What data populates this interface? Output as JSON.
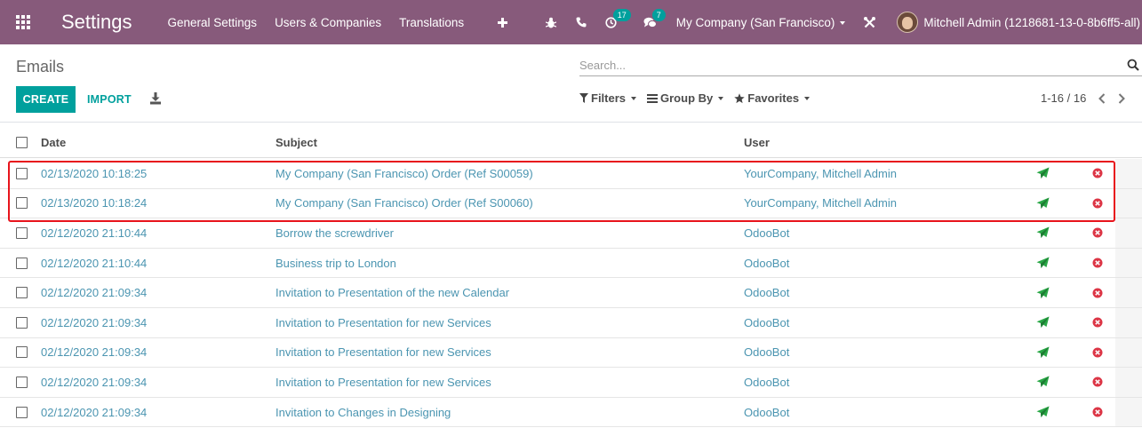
{
  "navbar": {
    "app_title": "Settings",
    "menu": [
      "General Settings",
      "Users & Companies",
      "Translations"
    ],
    "activity_count": "17",
    "messages_count": "7",
    "company": "My Company (San Francisco)",
    "user": "Mitchell Admin (1218681-13-0-8b6ff5-all)",
    "color": "#875a7b"
  },
  "control_panel": {
    "title": "Emails",
    "search_placeholder": "Search...",
    "create_label": "CREATE",
    "import_label": "IMPORT",
    "filters_label": "Filters",
    "groupby_label": "Group By",
    "favorites_label": "Favorites",
    "pager": "1-16 / 16",
    "accent": "#00a09d"
  },
  "table": {
    "columns": [
      "Date",
      "Subject",
      "User"
    ],
    "rows": [
      {
        "date": "02/13/2020 10:18:25",
        "subject": "My Company (San Francisco) Order (Ref S00059)",
        "user": "YourCompany, Mitchell Admin"
      },
      {
        "date": "02/13/2020 10:18:24",
        "subject": "My Company (San Francisco) Order (Ref S00060)",
        "user": "YourCompany, Mitchell Admin"
      },
      {
        "date": "02/12/2020 21:10:44",
        "subject": "Borrow the screwdriver",
        "user": "OdooBot"
      },
      {
        "date": "02/12/2020 21:10:44",
        "subject": "Business trip to London",
        "user": "OdooBot"
      },
      {
        "date": "02/12/2020 21:09:34",
        "subject": "Invitation to Presentation of the new Calendar",
        "user": "OdooBot"
      },
      {
        "date": "02/12/2020 21:09:34",
        "subject": "Invitation to Presentation for new Services",
        "user": "OdooBot"
      },
      {
        "date": "02/12/2020 21:09:34",
        "subject": "Invitation to Presentation for new Services",
        "user": "OdooBot"
      },
      {
        "date": "02/12/2020 21:09:34",
        "subject": "Invitation to Presentation for new Services",
        "user": "OdooBot"
      },
      {
        "date": "02/12/2020 21:09:34",
        "subject": "Invitation to Changes in Designing",
        "user": "OdooBot"
      }
    ],
    "send_icon": "paper-plane-icon",
    "cancel_icon": "times-circle-icon",
    "send_color": "#28a745",
    "cancel_color": "#dc3545",
    "highlight_color": "#e8141c"
  }
}
